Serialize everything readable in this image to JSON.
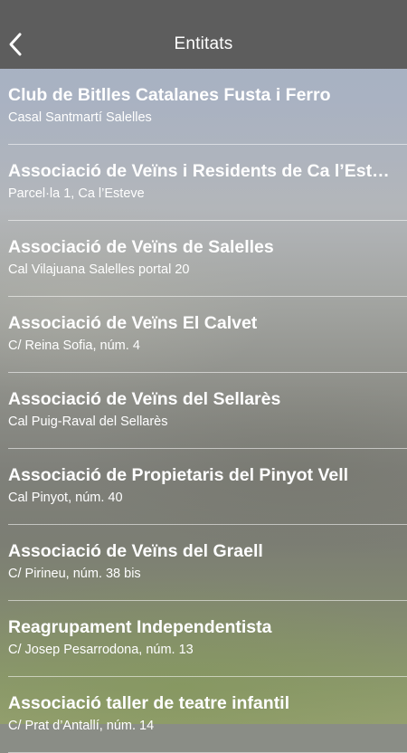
{
  "header": {
    "title": "Entitats",
    "back_icon": "chevron-left-icon",
    "background": "#5d5d5d"
  },
  "entities": [
    {
      "name": "Club de Bitlles Catalanes Fusta i Ferro",
      "address": "Casal Santmartí Salelles"
    },
    {
      "name": "Associació de Veïns i Residents de Ca l’Esteve",
      "address": "Parcel·la 1, Ca l’Esteve"
    },
    {
      "name": "Associació de Veïns de Salelles",
      "address": "Cal Vilajuana Salelles portal 20"
    },
    {
      "name": "Associació de Veïns El Calvet",
      "address": "C/ Reina Sofia, núm. 4"
    },
    {
      "name": "Associació de Veïns del Sellarès",
      "address": "Cal Puig-Raval del Sellarès"
    },
    {
      "name": "Associació de Propietaris del Pinyot Vell",
      "address": "Cal Pinyot, núm. 40"
    },
    {
      "name": "Associació de Veïns del Graell",
      "address": "C/ Pirineu, núm. 38 bis"
    },
    {
      "name": "Reagrupament Independentista",
      "address": "C/ Josep Pesarrodona, núm. 13"
    },
    {
      "name": "Associació taller de teatre infantil",
      "address": "C/ Prat d’Antallí, núm. 14"
    }
  ]
}
